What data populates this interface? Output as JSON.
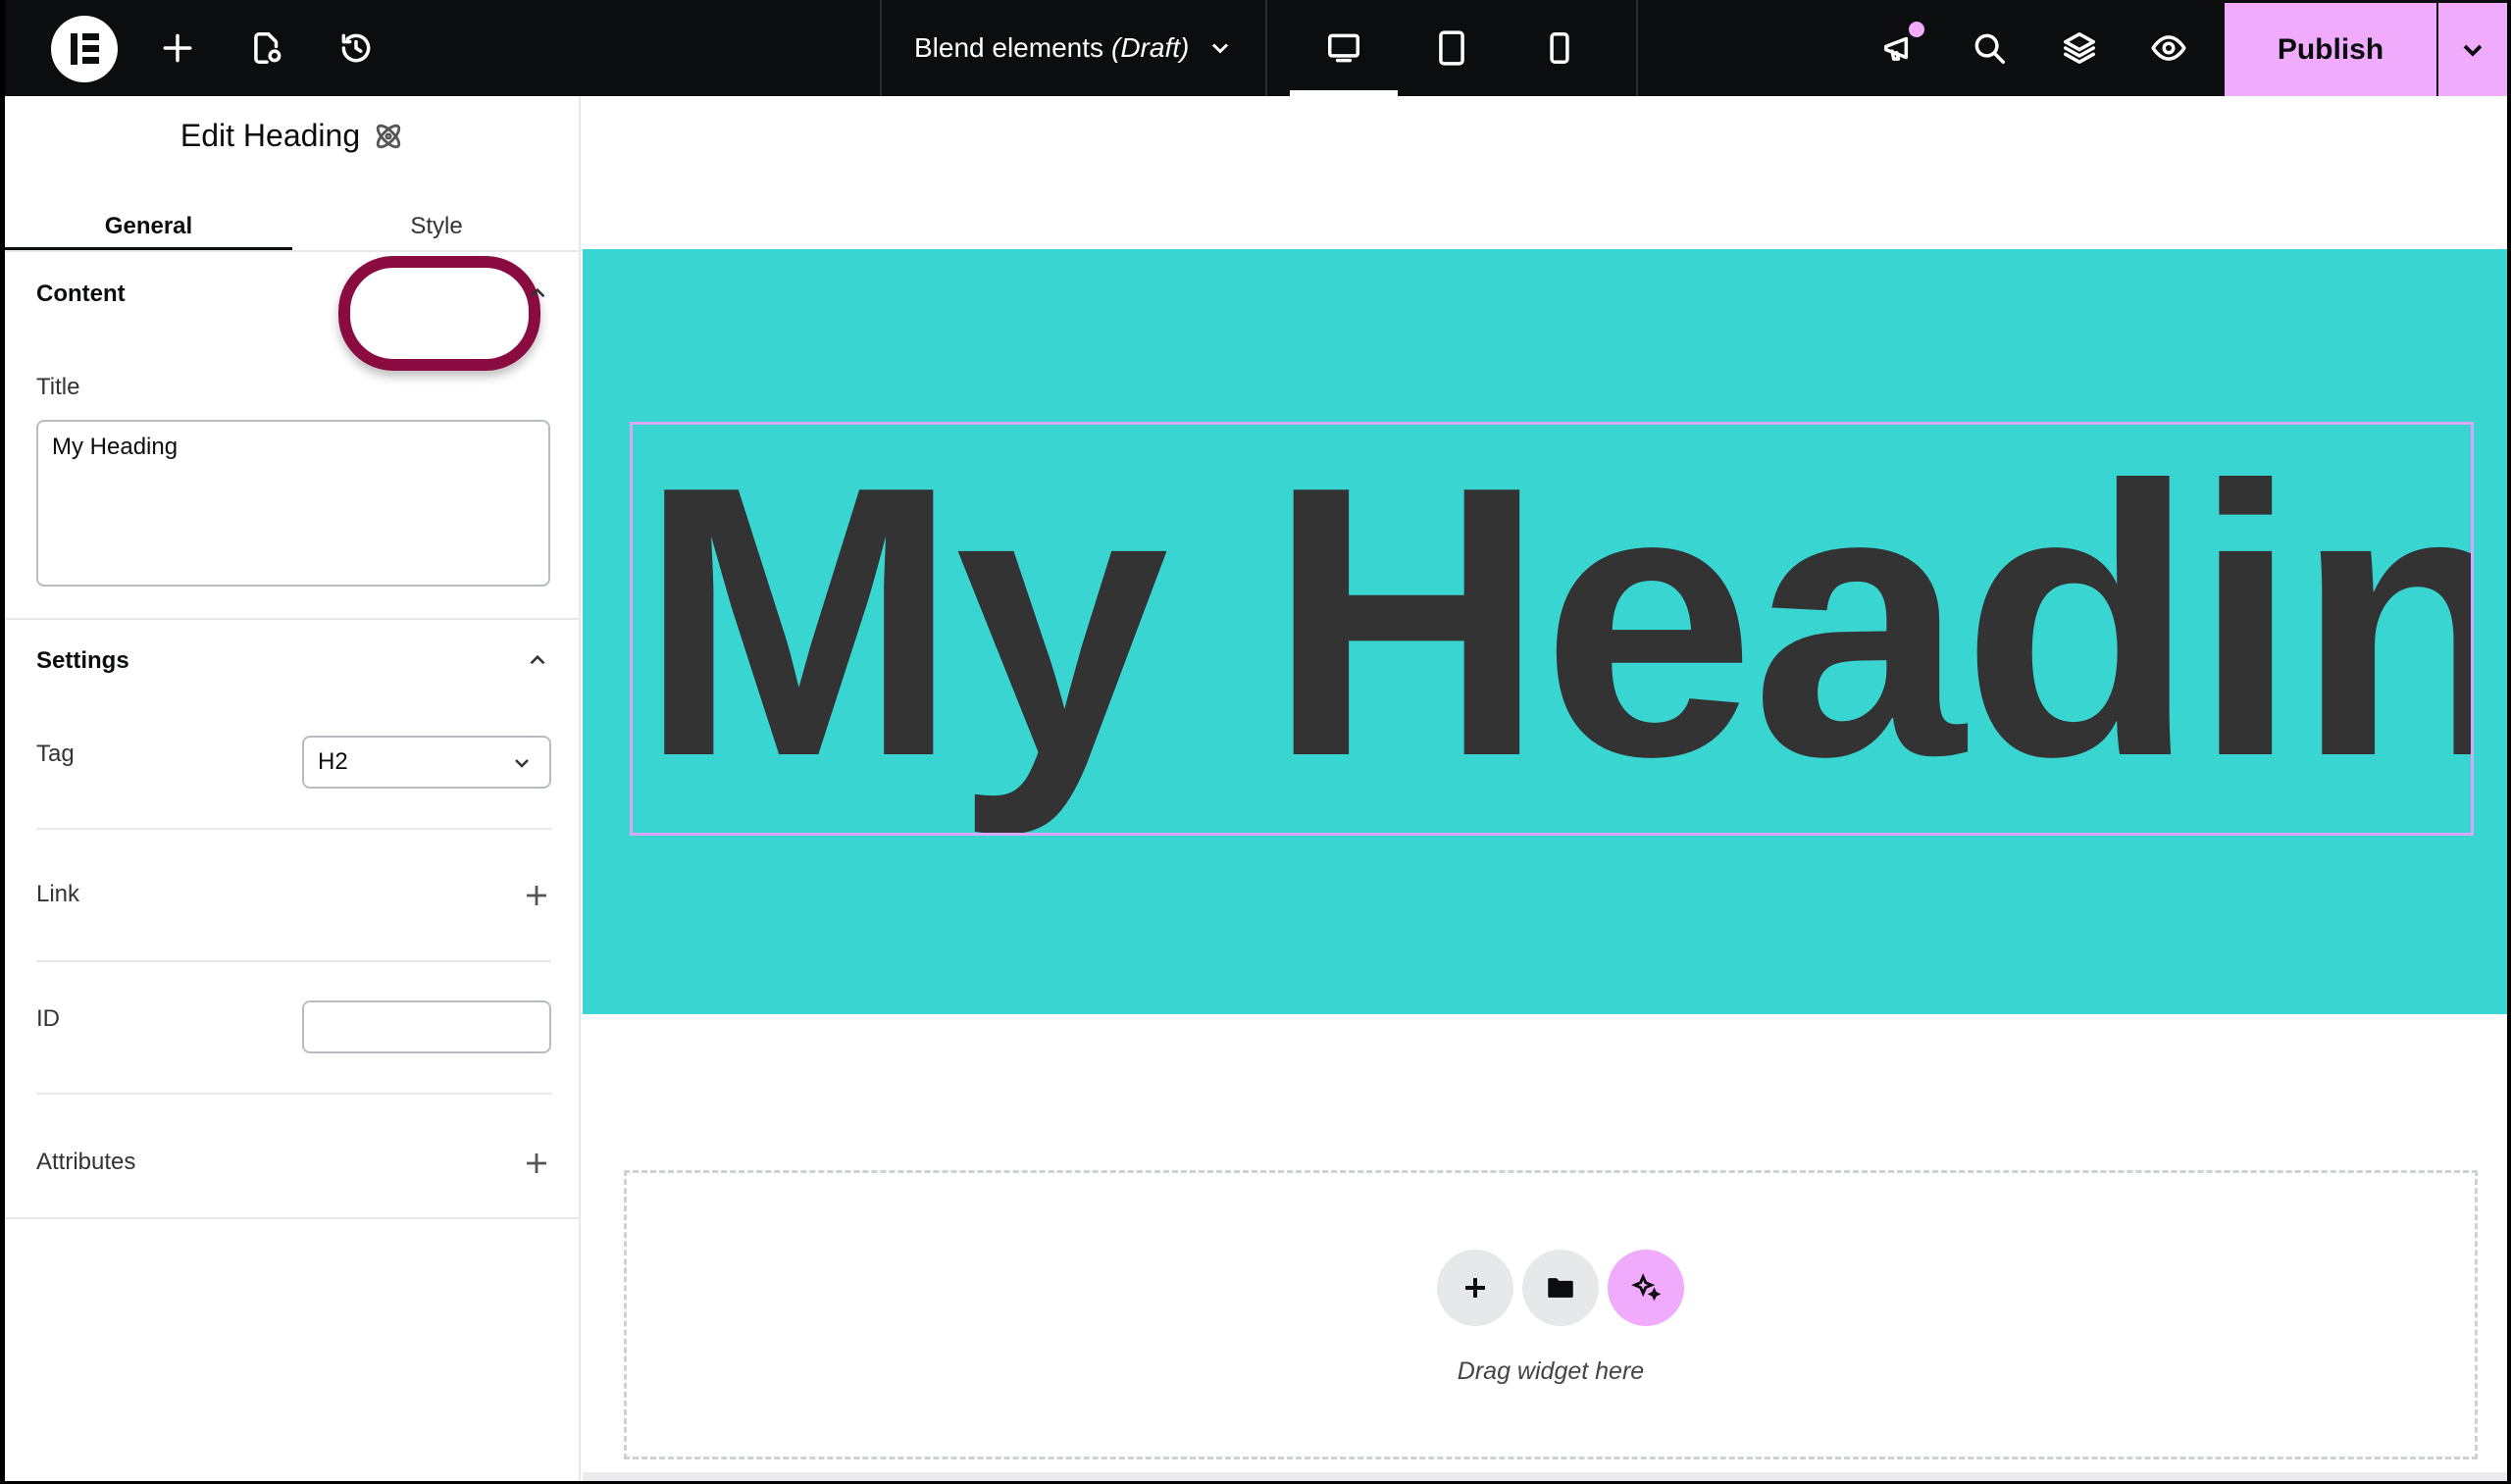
{
  "topbar": {
    "doc_title": "Blend elements",
    "doc_status": "(Draft)",
    "publish_label": "Publish",
    "icons": [
      "elementor-logo",
      "plus-icon",
      "page-settings-icon",
      "history-icon",
      "desktop-icon",
      "tablet-icon",
      "mobile-icon",
      "megaphone-icon",
      "search-icon",
      "layers-icon",
      "eye-icon",
      "chevron-down-icon"
    ],
    "accent_color": "#f0abfc"
  },
  "panel": {
    "title": "Edit Heading",
    "tabs": [
      {
        "label": "General",
        "active": true
      },
      {
        "label": "Style",
        "active": false
      }
    ],
    "content_section": {
      "heading": "Content",
      "title_label": "Title",
      "title_value": "My Heading"
    },
    "settings_section": {
      "heading": "Settings",
      "tag_label": "Tag",
      "tag_value": "H2",
      "link_label": "Link",
      "id_label": "ID",
      "id_value": "",
      "attributes_label": "Attributes"
    },
    "highlight_color": "#8a0b3f"
  },
  "canvas": {
    "heading_text": "My Heading",
    "hero_color": "#39d5d0",
    "heading_color": "#333333",
    "dropzone_text": "Drag widget here"
  }
}
